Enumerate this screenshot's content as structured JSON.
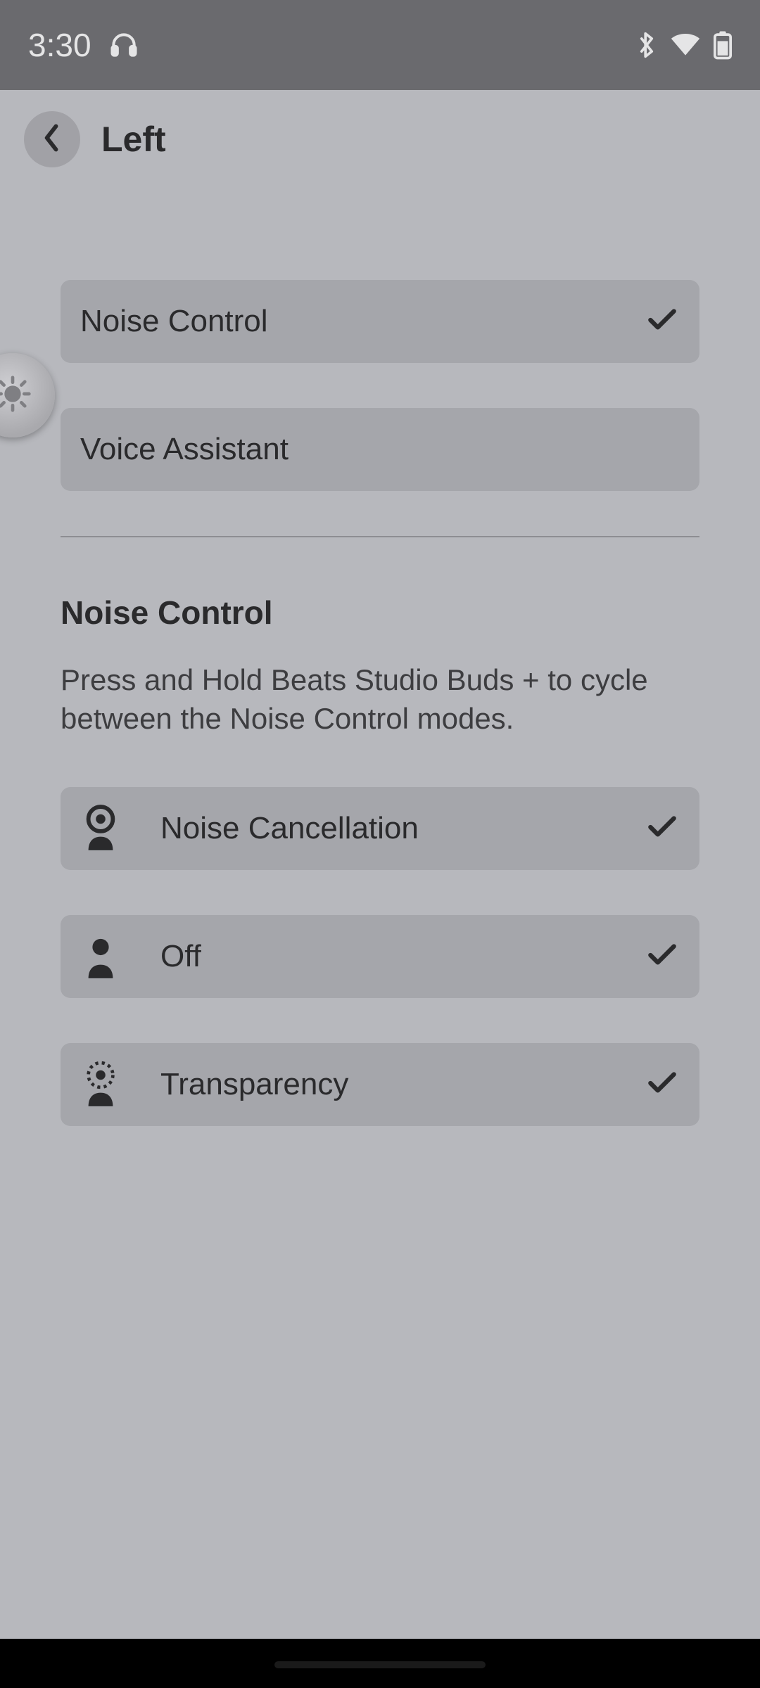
{
  "status": {
    "time": "3:30"
  },
  "header": {
    "title": "Left"
  },
  "actions": {
    "noise_control": {
      "label": "Noise Control",
      "selected": true
    },
    "voice_assistant": {
      "label": "Voice Assistant",
      "selected": false
    }
  },
  "section": {
    "title": "Noise Control",
    "description": "Press and Hold Beats Studio Buds + to cycle between the Noise Control modes."
  },
  "modes": [
    {
      "key": "noise_cancellation",
      "label": "Noise Cancellation",
      "selected": true,
      "icon": "head-solid-ring"
    },
    {
      "key": "off",
      "label": "Off",
      "selected": true,
      "icon": "head-dot"
    },
    {
      "key": "transparency",
      "label": "Transparency",
      "selected": true,
      "icon": "head-dotted-ring"
    }
  ]
}
